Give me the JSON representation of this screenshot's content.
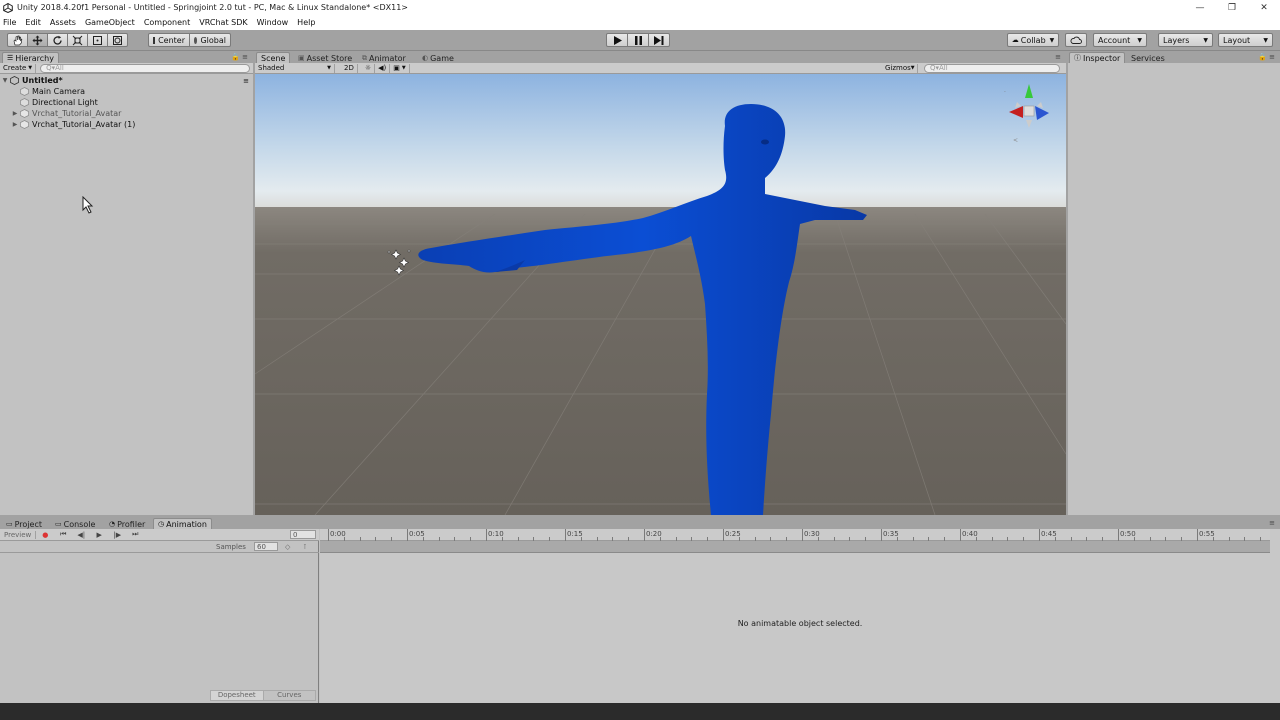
{
  "window": {
    "title": "Unity 2018.4.20f1 Personal - Untitled - Springjoint 2.0 tut - PC, Mac & Linux Standalone* <DX11>",
    "controls": [
      "—",
      "❐",
      "✕"
    ]
  },
  "menu": [
    "File",
    "Edit",
    "Assets",
    "GameObject",
    "Component",
    "VRChat SDK",
    "Window",
    "Help"
  ],
  "toolbar": {
    "pivot_label": "Center",
    "space_label": "Global",
    "collab_label": "Collab",
    "account_label": "Account",
    "layers_label": "Layers",
    "layout_label": "Layout"
  },
  "hierarchy": {
    "tab": "Hierarchy",
    "create_label": "Create",
    "search_placeholder": "Q▾All",
    "scene_name": "Untitled*",
    "items": [
      {
        "label": "Main Camera"
      },
      {
        "label": "Directional Light"
      },
      {
        "label": "Vrchat_Tutorial_Avatar"
      },
      {
        "label": "Vrchat_Tutorial_Avatar (1)"
      }
    ]
  },
  "scene": {
    "tabs": [
      "Scene",
      "Asset Store",
      "Animator",
      "Game"
    ],
    "shading_mode": "Shaded",
    "mode_2d": "2D",
    "gizmos_label": "Gizmos",
    "search_placeholder": "Q▾All",
    "colors": {
      "sky": "#8eb3e0",
      "ground": "#6f6a63",
      "avatar": "#0a49c9"
    }
  },
  "inspector": {
    "tabs": [
      "Inspector",
      "Services"
    ]
  },
  "animation": {
    "tabs": [
      "Project",
      "Console",
      "Profiler",
      "Animation"
    ],
    "preview_label": "Preview",
    "samples_label": "Samples",
    "samples_value": "60",
    "frame_value": "0",
    "ruler_ticks": [
      "0:00",
      "0:05",
      "0:10",
      "0:15",
      "0:20",
      "0:25",
      "0:30",
      "0:35",
      "0:40",
      "0:45",
      "0:50",
      "0:55"
    ],
    "empty_message": "No animatable object selected.",
    "bottom_tabs": [
      "Dopesheet",
      "Curves"
    ]
  }
}
